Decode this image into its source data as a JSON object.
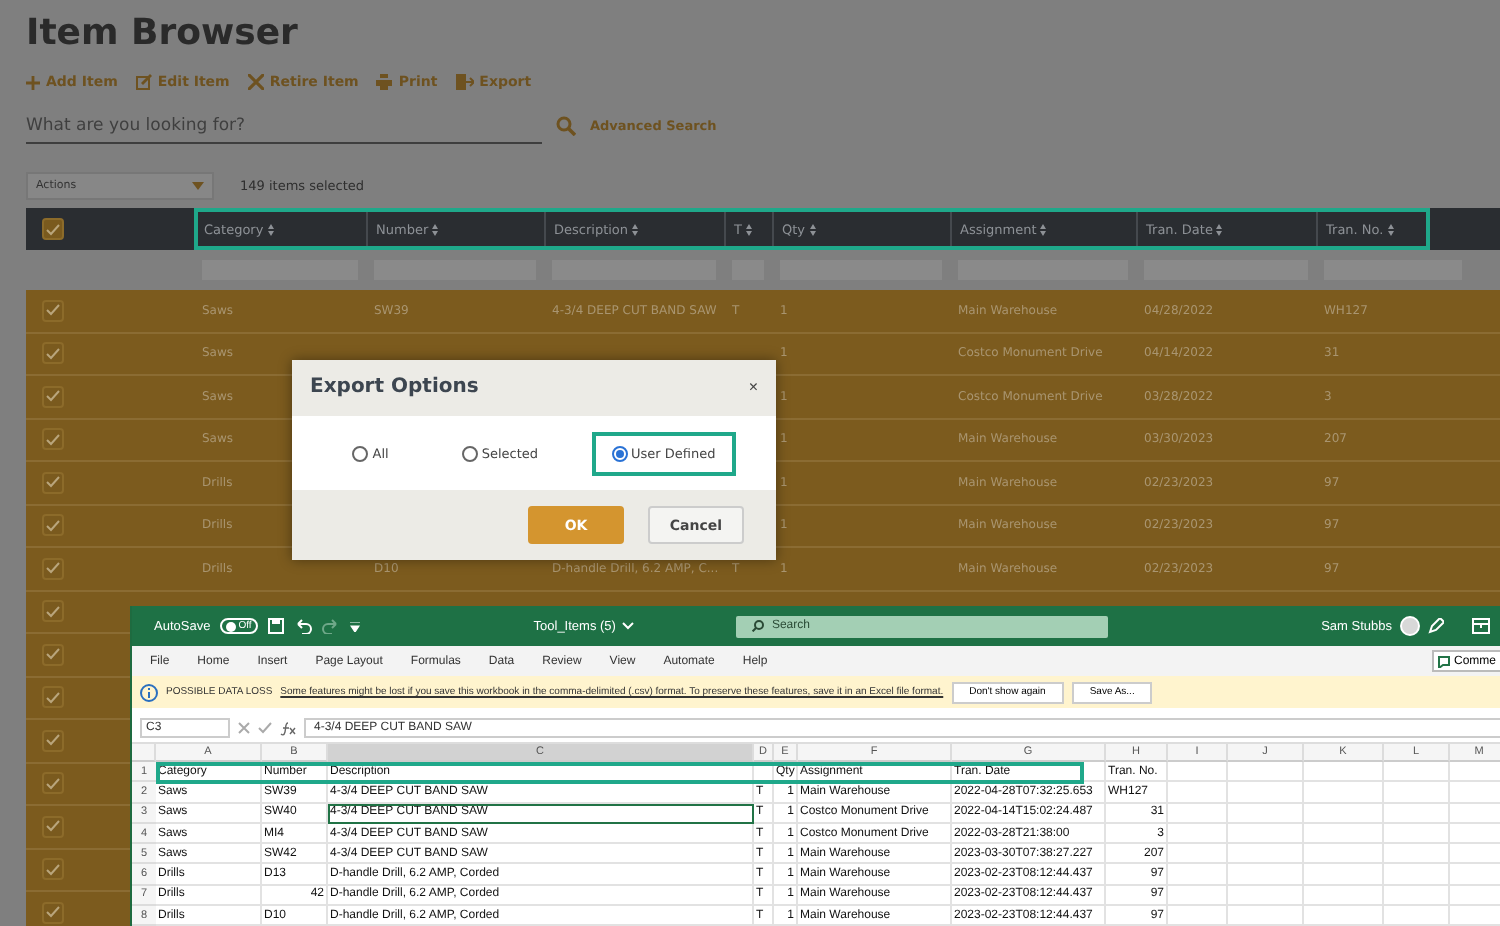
{
  "app": {
    "title": "Item Browser",
    "toolbar": [
      {
        "kind": "add",
        "label": "Add Item"
      },
      {
        "kind": "edit",
        "label": "Edit Item"
      },
      {
        "kind": "retire",
        "label": "Retire Item"
      },
      {
        "kind": "print",
        "label": "Print"
      },
      {
        "kind": "export",
        "label": "Export"
      }
    ],
    "search": {
      "placeholder": "What are you looking for?"
    },
    "advanced_search": "Advanced Search",
    "actions": {
      "value": "Actions"
    },
    "selection_count": "149 items selected",
    "table": {
      "select_all_checked": true,
      "header_highlighted": true,
      "columns": [
        "Category",
        "Number",
        "Description",
        "T",
        "Qty",
        "Assignment",
        "Tran. Date",
        "Tran. No."
      ],
      "rows": [
        {
          "checked": true,
          "category": "Saws",
          "number": "SW39",
          "description": "4-3/4 DEEP CUT BAND SAW",
          "t": "T",
          "qty": "1",
          "assignment": "Main Warehouse",
          "tran_date": "04/28/2022",
          "tran_no": "WH127"
        },
        {
          "checked": true,
          "category": "Saws",
          "qty": "1",
          "assignment": "Costco Monument Drive",
          "tran_date": "04/14/2022",
          "tran_no": "31"
        },
        {
          "checked": true,
          "category": "Saws",
          "qty": "1",
          "assignment": "Costco Monument Drive",
          "tran_date": "03/28/2022",
          "tran_no": "3"
        },
        {
          "checked": true,
          "category": "Saws",
          "qty": "1",
          "assignment": "Main Warehouse",
          "tran_date": "03/30/2023",
          "tran_no": "207"
        },
        {
          "checked": true,
          "category": "Drills",
          "qty": "1",
          "assignment": "Main Warehouse",
          "tran_date": "02/23/2023",
          "tran_no": "97"
        },
        {
          "checked": true,
          "category": "Drills",
          "qty": "1",
          "assignment": "Main Warehouse",
          "tran_date": "02/23/2023",
          "tran_no": "97"
        },
        {
          "checked": true,
          "category": "Drills",
          "number": "D10",
          "description": "D-handle Drill, 6.2 AMP, C...",
          "t": "T",
          "qty": "1",
          "assignment": "Main Warehouse",
          "tran_date": "02/23/2023",
          "tran_no": "97"
        },
        {
          "checked": true
        },
        {
          "checked": true
        },
        {
          "checked": true
        },
        {
          "checked": true
        },
        {
          "checked": true
        },
        {
          "checked": true
        },
        {
          "checked": true
        },
        {
          "checked": true
        }
      ]
    }
  },
  "dialog": {
    "title": "Export Options",
    "close": "×",
    "options": [
      {
        "label": "All",
        "selected": false,
        "highlighted": false
      },
      {
        "label": "Selected",
        "selected": false,
        "highlighted": false
      },
      {
        "label": "User Defined",
        "selected": true,
        "highlighted": true
      }
    ],
    "buttons": [
      {
        "kind": "primary",
        "label": "OK"
      },
      {
        "kind": "secondary",
        "label": "Cancel"
      }
    ]
  },
  "excel": {
    "autosave": {
      "label": "AutoSave",
      "on": false,
      "state_text": "Off"
    },
    "file_name": "Tool_Items (5)",
    "search_placeholder": "Search",
    "user": "Sam Stubbs",
    "menu": [
      "File",
      "Home",
      "Insert",
      "Page Layout",
      "Formulas",
      "Data",
      "Review",
      "View",
      "Automate",
      "Help"
    ],
    "comments_button": "Comme",
    "warning": {
      "title": "POSSIBLE DATA LOSS",
      "message": "Some features might be lost if you save this workbook in the comma-delimited (.csv) format. To preserve these features, save it in an Excel file format.",
      "buttons": [
        "Don't show again",
        "Save As..."
      ]
    },
    "name_box": "C3",
    "formula": "4-3/4 DEEP CUT BAND SAW",
    "columns": [
      {
        "label": "A",
        "selected": false
      },
      {
        "label": "B",
        "selected": false
      },
      {
        "label": "C",
        "selected": true
      },
      {
        "label": "D",
        "selected": false
      },
      {
        "label": "E",
        "selected": false
      },
      {
        "label": "F",
        "selected": false
      },
      {
        "label": "G",
        "selected": false
      },
      {
        "label": "H",
        "selected": false
      },
      {
        "label": "I",
        "selected": false
      },
      {
        "label": "J",
        "selected": false
      },
      {
        "label": "K",
        "selected": false
      },
      {
        "label": "L",
        "selected": false
      },
      {
        "label": "M",
        "selected": false
      }
    ],
    "rows": [
      {
        "number": "1",
        "selected": false,
        "highlighted": true,
        "cells": {
          "A": "Category",
          "B": "Number",
          "C": "Description",
          "E": "Qty",
          "F": "Assignment",
          "G": "Tran. Date",
          "H": "Tran. No."
        }
      },
      {
        "number": "2",
        "selected": false,
        "highlighted": false,
        "cells": {
          "A": "Saws",
          "B": "SW39",
          "C": "4-3/4 DEEP CUT BAND SAW",
          "D": "T",
          "E": "1",
          "F": "Main Warehouse",
          "G": "2022-04-28T07:32:25.653",
          "H": "WH127"
        }
      },
      {
        "number": "3",
        "selected": true,
        "highlighted": false,
        "cells": {
          "A": "Saws",
          "B": "SW40",
          "C": "4-3/4 DEEP CUT BAND SAW",
          "D": "T",
          "E": "1",
          "F": "Costco Monument Drive",
          "G": "2022-04-14T15:02:24.487",
          "H": "31"
        }
      },
      {
        "number": "4",
        "selected": false,
        "highlighted": false,
        "cells": {
          "A": "Saws",
          "B": "MI4",
          "C": "4-3/4 DEEP CUT BAND SAW",
          "D": "T",
          "E": "1",
          "F": "Costco Monument Drive",
          "G": "2022-03-28T21:38:00",
          "H": "3"
        }
      },
      {
        "number": "5",
        "selected": false,
        "highlighted": false,
        "cells": {
          "A": "Saws",
          "B": "SW42",
          "C": "4-3/4 DEEP CUT BAND SAW",
          "D": "T",
          "E": "1",
          "F": "Main Warehouse",
          "G": "2023-03-30T07:38:27.227",
          "H": "207"
        }
      },
      {
        "number": "6",
        "selected": false,
        "highlighted": false,
        "cells": {
          "A": "Drills",
          "B": "D13",
          "C": "D-handle Drill, 6.2 AMP, Corded",
          "D": "T",
          "E": "1",
          "F": "Main Warehouse",
          "G": "2023-02-23T08:12:44.437",
          "H": "97"
        }
      },
      {
        "number": "7",
        "selected": false,
        "highlighted": false,
        "cells": {
          "A": "Drills",
          "B": "42",
          "C": "D-handle Drill, 6.2 AMP, Corded",
          "D": "T",
          "E": "1",
          "F": "Main Warehouse",
          "G": "2023-02-23T08:12:44.437",
          "H": "97"
        }
      },
      {
        "number": "8",
        "selected": false,
        "highlighted": false,
        "cells": {
          "A": "Drills",
          "B": "D10",
          "C": "D-handle Drill, 6.2 AMP, Corded",
          "D": "T",
          "E": "1",
          "F": "Main Warehouse",
          "G": "2023-02-23T08:12:44.437",
          "H": "97"
        }
      }
    ]
  }
}
